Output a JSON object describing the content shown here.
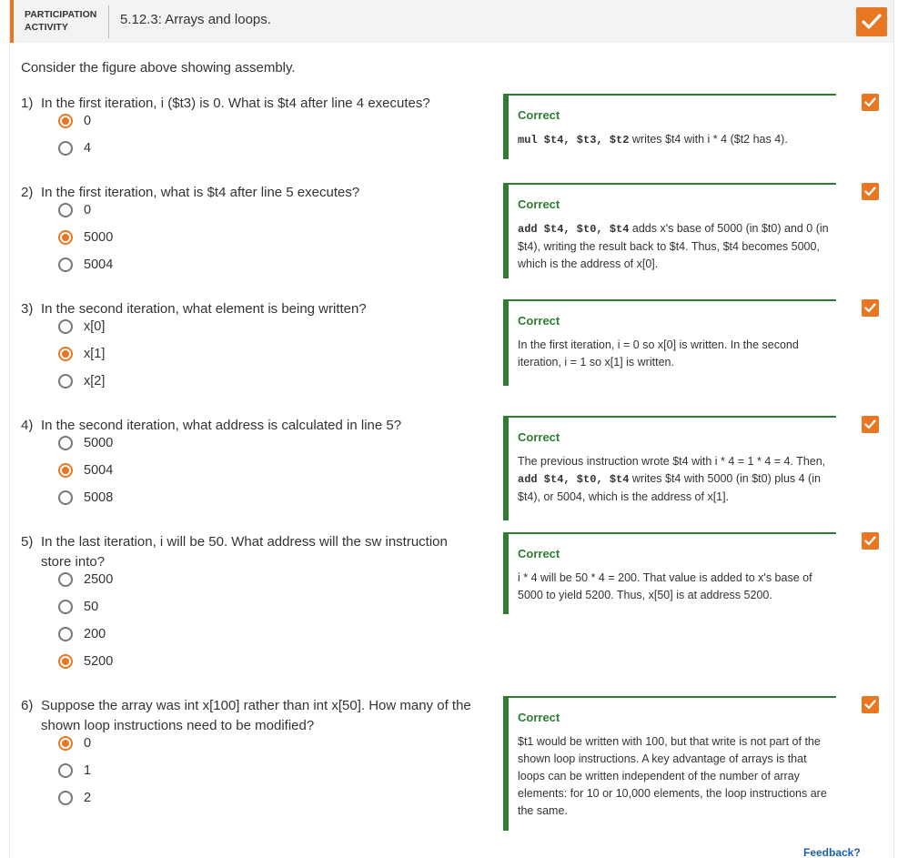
{
  "header": {
    "label": "PARTICIPATION ACTIVITY",
    "title": "5.12.3: Arrays and loops.",
    "accent_color": "#e87722",
    "check_icon": "check-icon"
  },
  "intro": "Consider the figure above showing assembly.",
  "questions": [
    {
      "num": "1)",
      "text": "In the first iteration, i ($t3) is 0. What is $t4 after line 4 executes?",
      "options": [
        {
          "label": "0",
          "selected": true
        },
        {
          "label": "4",
          "selected": false
        }
      ],
      "feedback": {
        "title": "Correct",
        "parts": [
          {
            "code": "mul $t4, $t3, $t2"
          },
          {
            "text": " writes $t4 with i * 4 ($t2 has 4)."
          }
        ]
      }
    },
    {
      "num": "2)",
      "text": "In the first iteration, what is $t4 after line 5 executes?",
      "options": [
        {
          "label": "0",
          "selected": false
        },
        {
          "label": "5000",
          "selected": true
        },
        {
          "label": "5004",
          "selected": false
        }
      ],
      "feedback": {
        "title": "Correct",
        "parts": [
          {
            "code": "add $t4, $t0, $t4"
          },
          {
            "text": " adds x's base of 5000 (in $t0) and 0 (in $t4), writing the result back to $t4. Thus, $t4 becomes 5000, which is the address of x[0]."
          }
        ]
      }
    },
    {
      "num": "3)",
      "text": "In the second iteration, what element is being written?",
      "options": [
        {
          "label": "x[0]",
          "selected": false
        },
        {
          "label": "x[1]",
          "selected": true
        },
        {
          "label": "x[2]",
          "selected": false
        }
      ],
      "feedback": {
        "title": "Correct",
        "parts": [
          {
            "text": "In the first iteration, i = 0 so x[0] is written. In the second iteration, i = 1 so x[1] is written."
          }
        ]
      }
    },
    {
      "num": "4)",
      "text": "In the second iteration, what address is calculated in line 5?",
      "options": [
        {
          "label": "5000",
          "selected": false
        },
        {
          "label": "5004",
          "selected": true
        },
        {
          "label": "5008",
          "selected": false
        }
      ],
      "feedback": {
        "title": "Correct",
        "parts": [
          {
            "text": "The previous instruction wrote $t4 with i * 4 = 1 * 4 = 4. Then, "
          },
          {
            "code": "add $t4, $t0, $t4"
          },
          {
            "text": " writes $t4 with 5000 (in $t0) plus 4 (in $t4), or 5004, which is the address of x[1]."
          }
        ]
      }
    },
    {
      "num": "5)",
      "text": "In the last iteration, i will be 50. What address will the sw instruction store into?",
      "options": [
        {
          "label": "2500",
          "selected": false
        },
        {
          "label": "50",
          "selected": false
        },
        {
          "label": "200",
          "selected": false
        },
        {
          "label": "5200",
          "selected": true
        }
      ],
      "feedback": {
        "title": "Correct",
        "parts": [
          {
            "text": "i * 4 will be 50 * 4 = 200. That value is added to x's base of 5000 to yield 5200. Thus, x[50] is at address 5200."
          }
        ]
      }
    },
    {
      "num": "6)",
      "text": "Suppose the array was int x[100] rather than int x[50]. How many of the shown loop instructions need to be modified?",
      "options": [
        {
          "label": "0",
          "selected": true
        },
        {
          "label": "1",
          "selected": false
        },
        {
          "label": "2",
          "selected": false
        }
      ],
      "feedback": {
        "title": "Correct",
        "parts": [
          {
            "text": "$t1 would be written with 100, but that write is not part of the shown loop instructions. A key advantage of arrays is that loops can be written independent of the number of array elements: for 10 or 10,000 elements, the loop instructions are the same."
          }
        ]
      }
    }
  ],
  "feedback_link": "Feedback?",
  "colors": {
    "correct": "#2e7d32",
    "link": "#1a5eab"
  }
}
